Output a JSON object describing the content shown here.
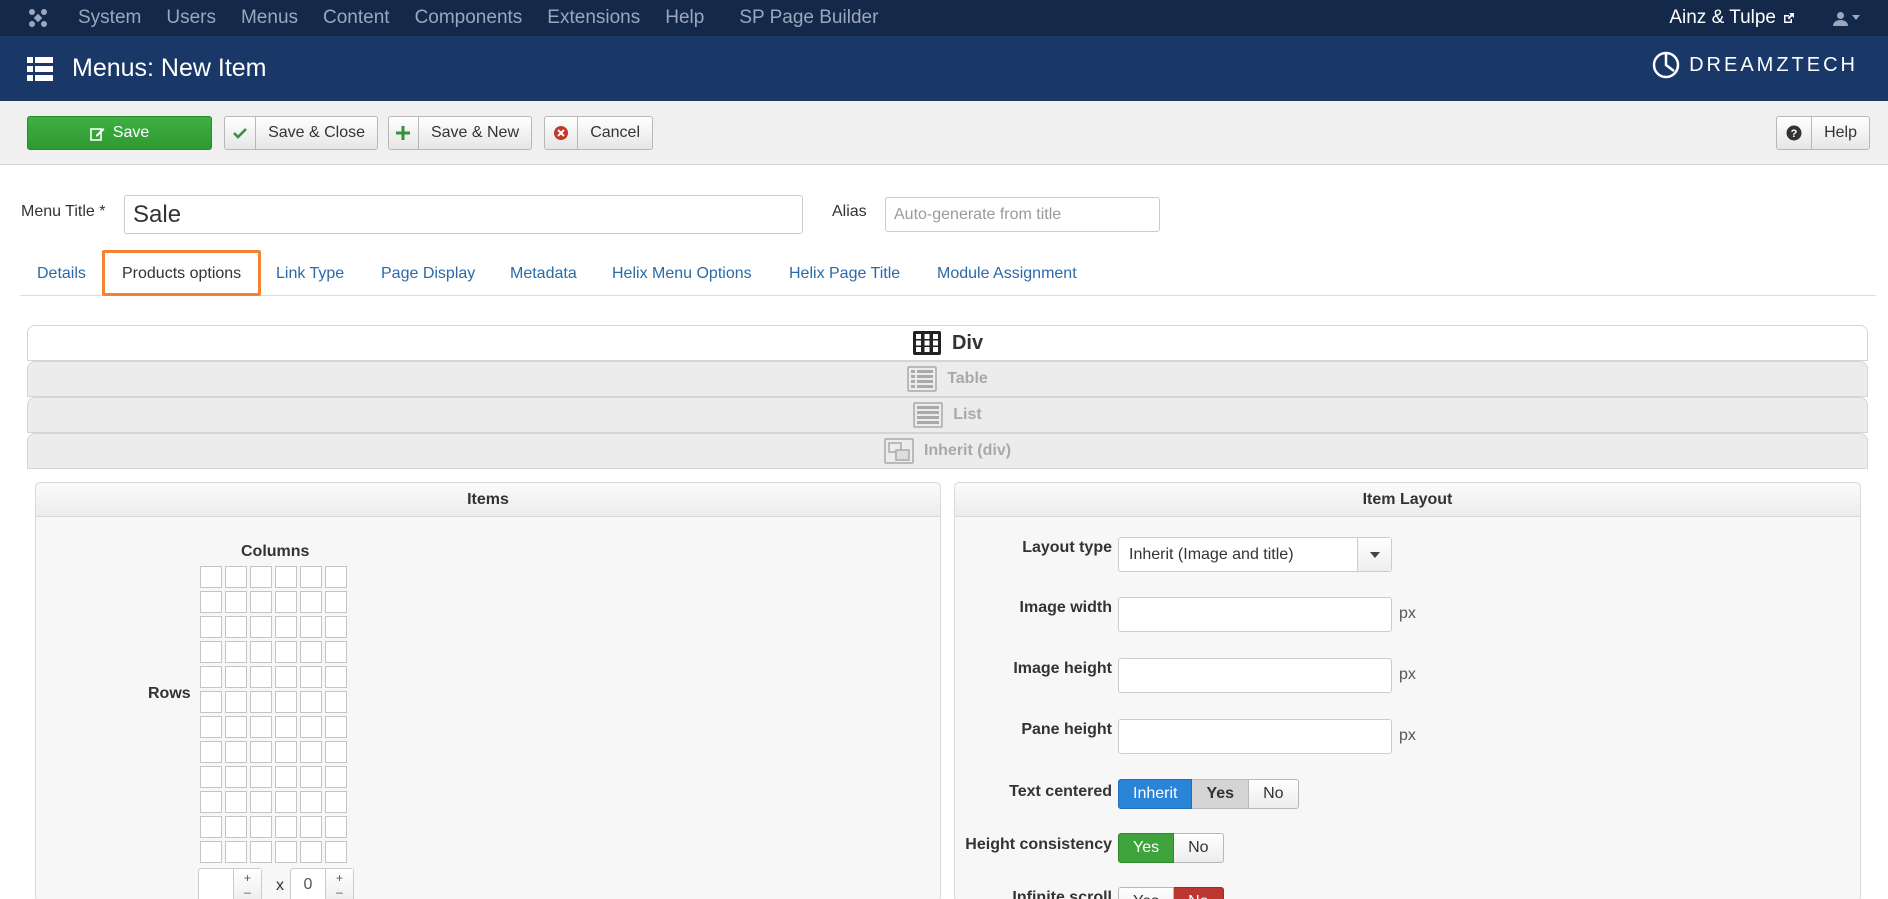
{
  "topnav": {
    "items": [
      "System",
      "Users",
      "Menus",
      "Content",
      "Components",
      "Extensions",
      "Help",
      "SP Page Builder"
    ],
    "site_name": "Ainz & Tulpe"
  },
  "header": {
    "title": "Menus: New Item",
    "brand": "DREAMZTECH"
  },
  "toolbar": {
    "save": "Save",
    "save_close": "Save & Close",
    "save_new": "Save & New",
    "cancel": "Cancel",
    "help": "Help"
  },
  "form": {
    "menu_title_label": "Menu Title *",
    "menu_title_value": "Sale",
    "alias_label": "Alias",
    "alias_placeholder": "Auto-generate from title"
  },
  "tabs": [
    "Details",
    "Products options",
    "Link Type",
    "Page Display",
    "Metadata",
    "Helix Menu Options",
    "Helix Page Title",
    "Module Assignment"
  ],
  "active_tab": "Products options",
  "layouts": {
    "div": "Div",
    "table": "Table",
    "list": "List",
    "inherit": "Inherit (div)"
  },
  "items_panel": {
    "title": "Items",
    "columns_label": "Columns",
    "rows_label": "Rows",
    "grid_columns": 6,
    "grid_rows": 12,
    "rows_value": "",
    "x": "x",
    "columns_value": "0",
    "plus": "+",
    "minus": "–"
  },
  "item_layout_panel": {
    "title": "Item Layout",
    "layout_type_label": "Layout type",
    "layout_type_value": "Inherit (Image and title)",
    "image_width_label": "Image width",
    "image_height_label": "Image height",
    "pane_height_label": "Pane height",
    "unit": "px",
    "text_centered_label": "Text centered",
    "text_centered_options": [
      "Inherit",
      "Yes",
      "No"
    ],
    "height_consistency_label": "Height consistency",
    "height_consistency_options": [
      "Yes",
      "No"
    ],
    "infinite_scroll_label": "Infinite scroll",
    "infinite_scroll_options": [
      "Yes",
      "No"
    ]
  },
  "colors": {
    "topnav_bg": "#142849",
    "header_bg": "#1a3867",
    "save_green": "#3fb041",
    "active_tab_border": "#f58233",
    "link_blue": "#2a6aa8"
  }
}
